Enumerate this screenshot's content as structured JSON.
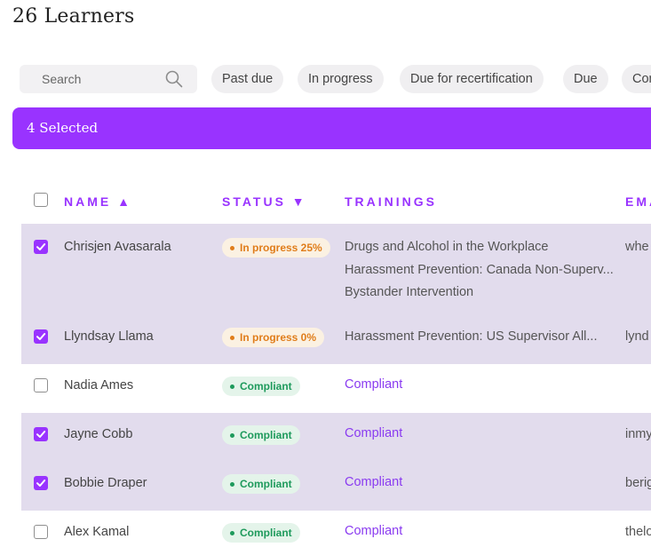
{
  "page": {
    "title": "26 Learners"
  },
  "search": {
    "placeholder": "Search"
  },
  "filters": [
    "Past due",
    "In progress",
    "Due for recertification",
    "Due",
    "Com"
  ],
  "selection": {
    "label": "4 Selected"
  },
  "columns": {
    "name": "NAME ▲",
    "status": "STATUS ▼",
    "trainings": "TRAININGS",
    "email": "EMA"
  },
  "rows": [
    {
      "name": "Chrisjen Avasarala",
      "selected": true,
      "status": "In progress 25%",
      "status_type": "in-progress",
      "trainings": [
        "Drugs and Alcohol in the Workplace",
        "Harassment Prevention: Canada Non-Superv...",
        "Bystander Intervention"
      ],
      "email": "whe"
    },
    {
      "name": "Llyndsay Llama",
      "selected": true,
      "status": "In progress 0%",
      "status_type": "in-progress",
      "trainings": [
        "Harassment Prevention: US Supervisor All..."
      ],
      "email": "lynd"
    },
    {
      "name": "Nadia Ames",
      "selected": false,
      "status": "Compliant",
      "status_type": "compliant",
      "trainings": [
        "Compliant"
      ],
      "email": ""
    },
    {
      "name": "Jayne Cobb",
      "selected": true,
      "status": "Compliant",
      "status_type": "compliant",
      "trainings": [
        "Compliant"
      ],
      "email": "inmy"
    },
    {
      "name": "Bobbie Draper",
      "selected": true,
      "status": "Compliant",
      "status_type": "compliant",
      "trainings": [
        "Compliant"
      ],
      "email": "berig"
    },
    {
      "name": "Alex Kamal",
      "selected": false,
      "status": "Compliant",
      "status_type": "compliant",
      "trainings": [
        "Compliant"
      ],
      "email": "thelo"
    }
  ],
  "colors": {
    "accent": "#9933ff",
    "selected_row": "#e2dced",
    "in_progress": "#e07d1b",
    "compliant": "#1e9a5c"
  }
}
